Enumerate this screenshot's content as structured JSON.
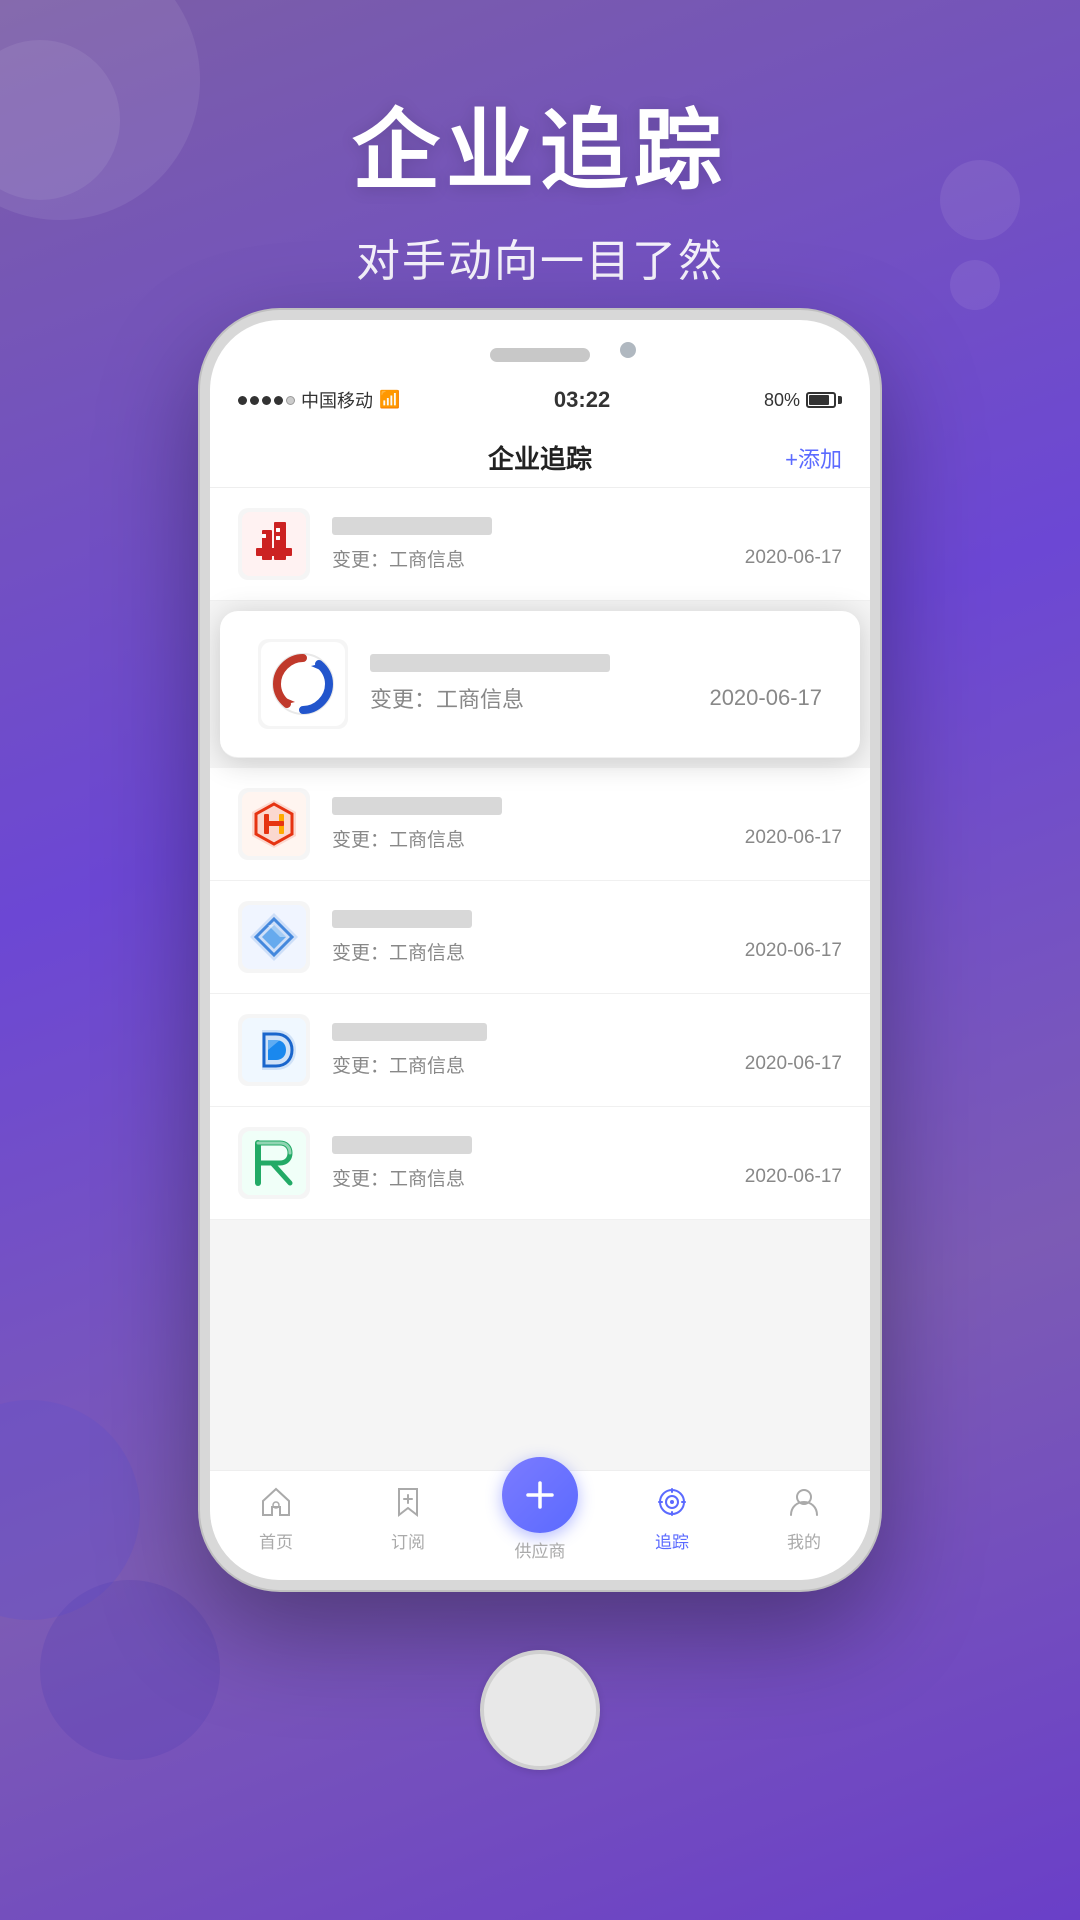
{
  "background": {
    "gradient_start": "#7b5ea7",
    "gradient_end": "#6c47d4"
  },
  "header": {
    "main_title": "企业追踪",
    "sub_title": "对手动向一目了然"
  },
  "status_bar": {
    "carrier": "中国移动",
    "time": "03:22",
    "battery": "80%"
  },
  "nav": {
    "title": "企业追踪",
    "add_button": "+添加"
  },
  "companies": [
    {
      "id": 1,
      "name_blur1": 60,
      "name_show": "",
      "change_label": "变更：工商信息",
      "date": "2020-06-17",
      "highlighted": false,
      "logo_type": "red-building"
    },
    {
      "id": 2,
      "name_blur1": 220,
      "name_show": "",
      "change_label": "变更：工商信息",
      "date": "2020-06-17",
      "highlighted": true,
      "logo_type": "blue-circular"
    },
    {
      "id": 3,
      "name_blur1": 160,
      "name_show": "",
      "change_label": "变更：工商信息",
      "date": "2020-06-17",
      "highlighted": false,
      "logo_type": "red-hexagon"
    },
    {
      "id": 4,
      "name_blur1": 130,
      "name_show": "",
      "change_label": "变更：工商信息",
      "date": "2020-06-17",
      "highlighted": false,
      "logo_type": "blue-diamond"
    },
    {
      "id": 5,
      "name_blur1": 150,
      "name_show": "",
      "change_label": "变更：工商信息",
      "date": "2020-06-17",
      "highlighted": false,
      "logo_type": "blue-energy"
    },
    {
      "id": 6,
      "name_blur1": 130,
      "name_show": "",
      "change_label": "变更：工商信息",
      "date": "2020-06-17",
      "highlighted": false,
      "logo_type": "green-rh"
    }
  ],
  "tabs": [
    {
      "label": "首页",
      "icon": "home",
      "active": false
    },
    {
      "label": "订阅",
      "icon": "bookmark",
      "active": false
    },
    {
      "label": "供应商",
      "icon": "plus",
      "active": false,
      "center": true
    },
    {
      "label": "追踪",
      "icon": "track",
      "active": true
    },
    {
      "label": "我的",
      "icon": "person",
      "active": false
    }
  ]
}
